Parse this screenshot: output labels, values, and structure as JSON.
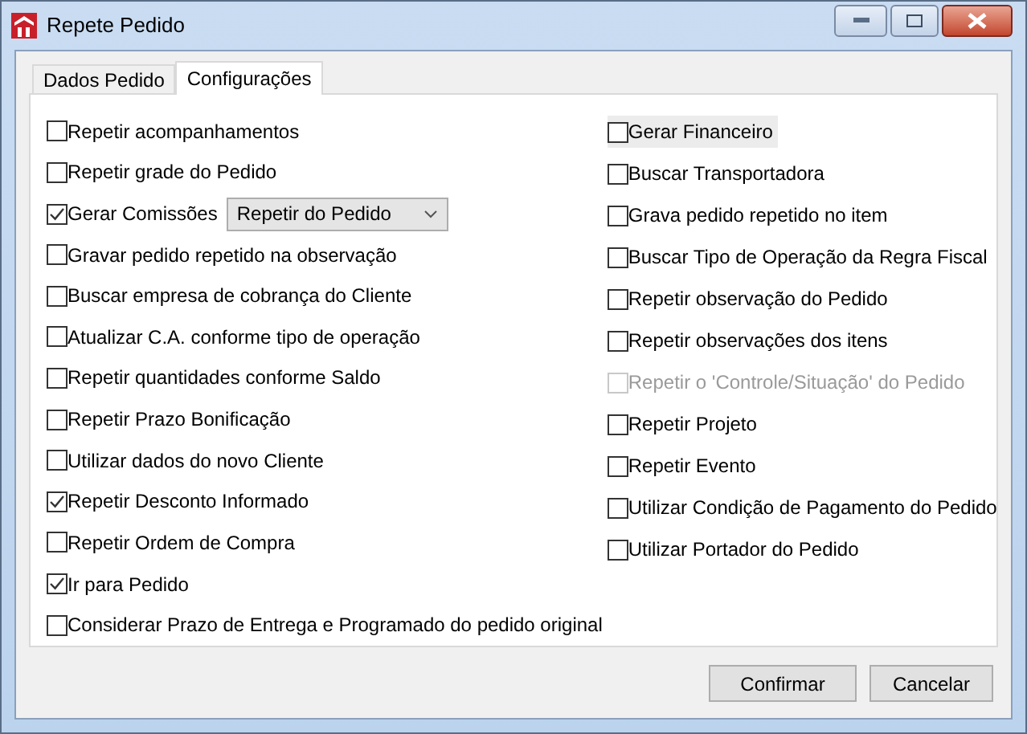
{
  "window": {
    "title": "Repete Pedido"
  },
  "tabs": [
    {
      "label": "Dados Pedido",
      "selected": false
    },
    {
      "label": "Configurações",
      "selected": true
    }
  ],
  "left_options": [
    {
      "kind": "checkbox",
      "label": "Repetir acompanhamentos",
      "checked": false
    },
    {
      "kind": "checkbox",
      "label": "Repetir grade do Pedido",
      "checked": false
    },
    {
      "kind": "checkbox_select",
      "label": "Gerar Comissões",
      "checked": true,
      "select_value": "Repetir do Pedido"
    },
    {
      "kind": "checkbox",
      "label": "Gravar pedido repetido na observação",
      "checked": false
    },
    {
      "kind": "checkbox",
      "label": "Buscar empresa de cobrança do Cliente",
      "checked": false
    },
    {
      "kind": "checkbox",
      "label": "Atualizar C.A. conforme tipo de operação",
      "checked": false
    },
    {
      "kind": "checkbox",
      "label": "Repetir quantidades conforme Saldo",
      "checked": false
    },
    {
      "kind": "checkbox",
      "label": "Repetir Prazo Bonificação",
      "checked": false
    },
    {
      "kind": "checkbox",
      "label": "Utilizar dados do novo Cliente",
      "checked": false
    },
    {
      "kind": "checkbox",
      "label": "Repetir Desconto Informado",
      "checked": true
    },
    {
      "kind": "checkbox",
      "label": "Repetir Ordem de Compra",
      "checked": false
    },
    {
      "kind": "checkbox",
      "label": "Ir para Pedido",
      "checked": true
    },
    {
      "kind": "checkbox",
      "label": "Considerar Prazo de Entrega e Programado do pedido original",
      "checked": false
    }
  ],
  "right_options": [
    {
      "label": "Gerar Financeiro",
      "checked": false,
      "focused": true,
      "disabled": false
    },
    {
      "label": "Buscar Transportadora",
      "checked": false,
      "focused": false,
      "disabled": false
    },
    {
      "label": "Grava pedido repetido no item",
      "checked": false,
      "focused": false,
      "disabled": false
    },
    {
      "label": "Buscar Tipo de Operação da Regra Fiscal",
      "checked": false,
      "focused": false,
      "disabled": false
    },
    {
      "label": "Repetir observação do Pedido",
      "checked": false,
      "focused": false,
      "disabled": false
    },
    {
      "label": "Repetir observações dos itens",
      "checked": false,
      "focused": false,
      "disabled": false
    },
    {
      "label": "Repetir o 'Controle/Situação' do Pedido",
      "checked": false,
      "focused": false,
      "disabled": true
    },
    {
      "label": "Repetir Projeto",
      "checked": false,
      "focused": false,
      "disabled": false
    },
    {
      "label": "Repetir Evento",
      "checked": false,
      "focused": false,
      "disabled": false
    },
    {
      "label": "Utilizar Condição de Pagamento do Pedido",
      "checked": false,
      "focused": false,
      "disabled": false
    },
    {
      "label": "Utilizar Portador do Pedido",
      "checked": false,
      "focused": false,
      "disabled": false
    }
  ],
  "buttons": [
    "Confirmar",
    "Cancelar"
  ]
}
